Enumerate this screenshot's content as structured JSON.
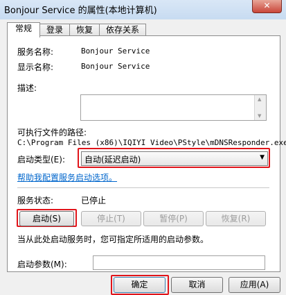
{
  "window": {
    "title": "Bonjour Service 的属性(本地计算机)",
    "close_glyph": "✕"
  },
  "tabs": [
    {
      "label": "常规",
      "active": true
    },
    {
      "label": "登录",
      "active": false
    },
    {
      "label": "恢复",
      "active": false
    },
    {
      "label": "依存关系",
      "active": false
    }
  ],
  "general": {
    "service_name_label": "服务名称:",
    "service_name_value": "Bonjour Service",
    "display_name_label": "显示名称:",
    "display_name_value": "Bonjour Service",
    "description_label": "描述:",
    "description_value": "",
    "path_label": "可执行文件的路径:",
    "path_value": "C:\\Program Files (x86)\\IQIYI Video\\PStyle\\mDNSResponder.exe",
    "startup_type_label": "启动类型(E):",
    "startup_type_value": "自动(延迟启动)",
    "help_link": "帮助我配置服务启动选项。",
    "status_label": "服务状态:",
    "status_value": "已停止",
    "buttons": {
      "start": "启动(S)",
      "stop": "停止(T)",
      "pause": "暂停(P)",
      "resume": "恢复(R)"
    },
    "hint": "当从此处启动服务时，您可指定所适用的启动参数。",
    "params_label": "启动参数(M):",
    "params_value": ""
  },
  "footer": {
    "ok": "确定",
    "cancel": "取消",
    "apply": "应用(A)"
  },
  "colors": {
    "highlight": "#e1141a",
    "link": "#0066cc"
  }
}
